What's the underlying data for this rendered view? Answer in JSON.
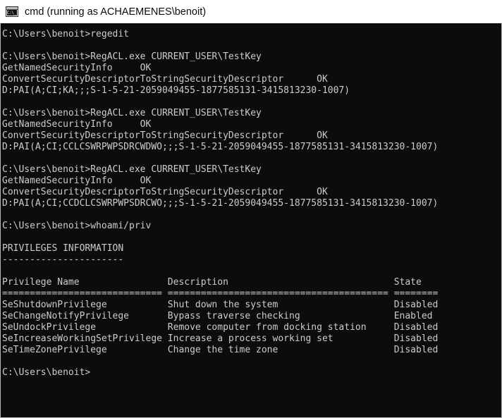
{
  "window": {
    "title": "cmd (running as ACHAEMENES\\benoit)",
    "icon": "cmd-console-icon",
    "icon_glyph": "C:\\_",
    "background_color": "#0c0c0c",
    "foreground_color": "#cccccc",
    "titlebar_color": "#ffffff",
    "border_color": "#b5b5b5"
  },
  "console": {
    "prompt": "C:\\Users\\benoit>",
    "cursor_visible": false,
    "lines": [
      "C:\\Users\\benoit>regedit",
      "",
      "C:\\Users\\benoit>RegACL.exe CURRENT_USER\\TestKey",
      "GetNamedSecurityInfo     OK",
      "ConvertSecurityDescriptorToStringSecurityDescriptor      OK",
      "D:PAI(A;CI;KA;;;S-1-5-21-2059049455-1877585131-3415813230-1007)",
      "",
      "C:\\Users\\benoit>RegACL.exe CURRENT_USER\\TestKey",
      "GetNamedSecurityInfo     OK",
      "ConvertSecurityDescriptorToStringSecurityDescriptor      OK",
      "D:PAI(A;CI;CCLCSWRPWPSDRCWDWO;;;S-1-5-21-2059049455-1877585131-3415813230-1007)",
      "",
      "C:\\Users\\benoit>RegACL.exe CURRENT_USER\\TestKey",
      "GetNamedSecurityInfo     OK",
      "ConvertSecurityDescriptorToStringSecurityDescriptor      OK",
      "D:PAI(A;CI;CCDCLCSWRPWPSDRCWO;;;S-1-5-21-2059049455-1877585131-3415813230-1007)",
      "",
      "C:\\Users\\benoit>whoami/priv",
      "",
      "PRIVILEGES INFORMATION",
      "----------------------",
      "",
      "Privilege Name                Description                              State",
      "============================= ======================================== ========",
      "SeShutdownPrivilege           Shut down the system                     Disabled",
      "SeChangeNotifyPrivilege       Bypass traverse checking                 Enabled",
      "SeUndockPrivilege             Remove computer from docking station     Disabled",
      "SeIncreaseWorkingSetPrivilege Increase a process working set           Disabled",
      "SeTimeZonePrivilege           Change the time zone                     Disabled",
      "",
      "C:\\Users\\benoit>"
    ],
    "commands": [
      "regedit",
      "RegACL.exe CURRENT_USER\\TestKey",
      "RegACL.exe CURRENT_USER\\TestKey",
      "RegACL.exe CURRENT_USER\\TestKey",
      "whoami/priv"
    ],
    "regacl_results": [
      {
        "get_named_security_info": "OK",
        "convert_security_descriptor_to_string_security_descriptor": "OK",
        "sddl": "D:PAI(A;CI;KA;;;S-1-5-21-2059049455-1877585131-3415813230-1007)"
      },
      {
        "get_named_security_info": "OK",
        "convert_security_descriptor_to_string_security_descriptor": "OK",
        "sddl": "D:PAI(A;CI;CCLCSWRPWPSDRCWDWO;;;S-1-5-21-2059049455-1877585131-3415813230-1007)"
      },
      {
        "get_named_security_info": "OK",
        "convert_security_descriptor_to_string_security_descriptor": "OK",
        "sddl": "D:PAI(A;CI;CCDCLCSWRPWPSDRCWO;;;S-1-5-21-2059049455-1877585131-3415813230-1007)"
      }
    ],
    "privileges_section": {
      "heading": "PRIVILEGES INFORMATION",
      "underline": "----------------------",
      "columns": [
        "Privilege Name",
        "Description",
        "State"
      ],
      "column_rules": [
        "=============================",
        "========================================",
        "========"
      ],
      "rows": [
        {
          "name": "SeShutdownPrivilege",
          "description": "Shut down the system",
          "state": "Disabled"
        },
        {
          "name": "SeChangeNotifyPrivilege",
          "description": "Bypass traverse checking",
          "state": "Enabled"
        },
        {
          "name": "SeUndockPrivilege",
          "description": "Remove computer from docking station",
          "state": "Disabled"
        },
        {
          "name": "SeIncreaseWorkingSetPrivilege",
          "description": "Increase a process working set",
          "state": "Disabled"
        },
        {
          "name": "SeTimeZonePrivilege",
          "description": "Change the time zone",
          "state": "Disabled"
        }
      ]
    }
  }
}
